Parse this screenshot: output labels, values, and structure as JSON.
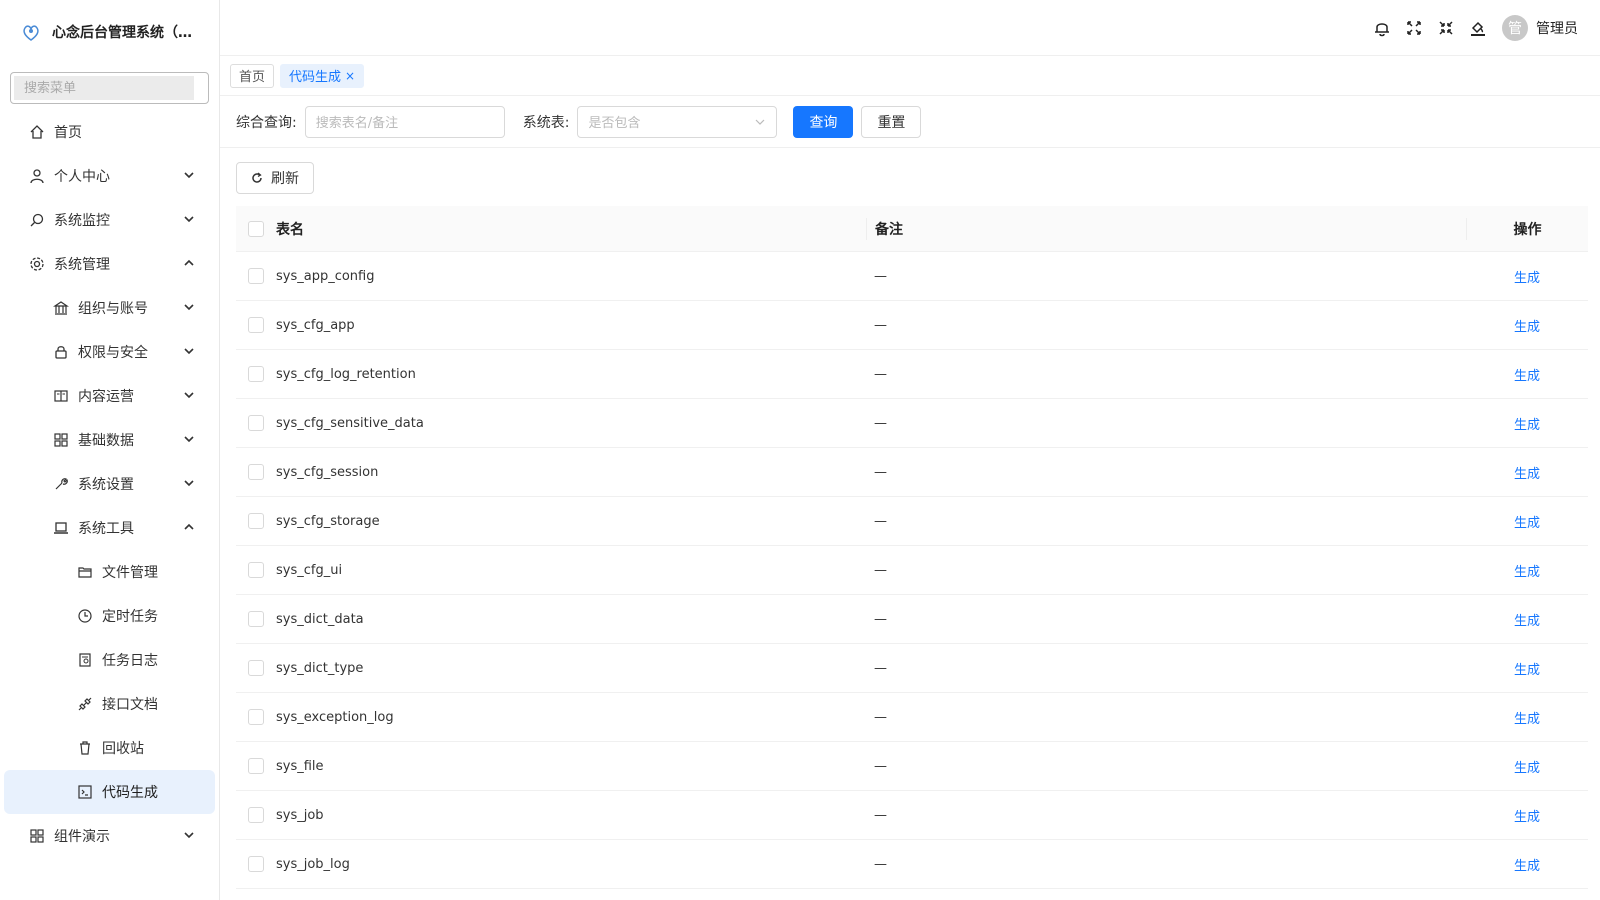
{
  "app": {
    "title": "心念后台管理系统（R..."
  },
  "sidebar": {
    "search_placeholder": "搜索菜单",
    "items": [
      {
        "label": "首页"
      },
      {
        "label": "个人中心"
      },
      {
        "label": "系统监控"
      },
      {
        "label": "系统管理"
      },
      {
        "label": "组织与账号"
      },
      {
        "label": "权限与安全"
      },
      {
        "label": "内容运营"
      },
      {
        "label": "基础数据"
      },
      {
        "label": "系统设置"
      },
      {
        "label": "系统工具"
      },
      {
        "label": "文件管理"
      },
      {
        "label": "定时任务"
      },
      {
        "label": "任务日志"
      },
      {
        "label": "接口文档"
      },
      {
        "label": "回收站"
      },
      {
        "label": "代码生成"
      },
      {
        "label": "组件演示"
      }
    ]
  },
  "header": {
    "avatar_char": "管",
    "user_name": "管理员"
  },
  "tabs": [
    {
      "label": "首页"
    },
    {
      "label": "代码生成",
      "close": "×"
    }
  ],
  "filters": {
    "query_label": "综合查询:",
    "query_placeholder": "搜索表名/备注",
    "systable_label": "系统表:",
    "systable_placeholder": "是否包含",
    "search_btn": "查询",
    "reset_btn": "重置"
  },
  "toolbar": {
    "refresh_btn": "刷新"
  },
  "table": {
    "columns": [
      "表名",
      "备注",
      "操作"
    ],
    "op_label": "生成",
    "rows": [
      {
        "name": "sys_app_config",
        "note": "—"
      },
      {
        "name": "sys_cfg_app",
        "note": "—"
      },
      {
        "name": "sys_cfg_log_retention",
        "note": "—"
      },
      {
        "name": "sys_cfg_sensitive_data",
        "note": "—"
      },
      {
        "name": "sys_cfg_session",
        "note": "—"
      },
      {
        "name": "sys_cfg_storage",
        "note": "—"
      },
      {
        "name": "sys_cfg_ui",
        "note": "—"
      },
      {
        "name": "sys_dict_data",
        "note": "—"
      },
      {
        "name": "sys_dict_type",
        "note": "—"
      },
      {
        "name": "sys_exception_log",
        "note": "—"
      },
      {
        "name": "sys_file",
        "note": "—"
      },
      {
        "name": "sys_job",
        "note": "—"
      },
      {
        "name": "sys_job_log",
        "note": "—"
      }
    ]
  },
  "colors": {
    "primary": "#1677ff",
    "active_bg": "#e8f1fd"
  }
}
